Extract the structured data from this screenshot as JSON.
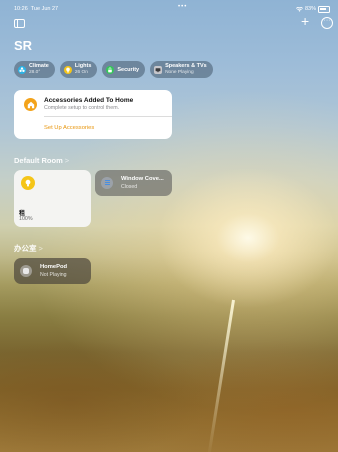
{
  "status_bar": {
    "time": "10:26",
    "date": "Tue Jun 27",
    "dots": "•••",
    "wifi": "wifi-icon",
    "battery_pct": "83%"
  },
  "home": {
    "title": "SR"
  },
  "pills": [
    {
      "label": "Climate",
      "sub": "28.0°",
      "icon": "fan-icon",
      "color": "#2bb3e6"
    },
    {
      "label": "Lights",
      "sub": "26 On",
      "icon": "bulb-icon",
      "color": "#f5c518"
    },
    {
      "label": "Security",
      "icon": "lock-icon",
      "color": "#34c759"
    },
    {
      "label": "Speakers & TVs",
      "sub": "None Playing",
      "icon": "tv-icon",
      "color": "#c7c7cc"
    }
  ],
  "accessories_card": {
    "title": "Accessories Added To Home",
    "subtitle": "Complete setup to control them.",
    "link": "Set Up Accessories",
    "icon": "home-icon",
    "icon_color": "#f3a31b"
  },
  "sections": [
    {
      "title": "Default Room",
      "chevron": ">",
      "tiles": [
        {
          "name": "租",
          "status": "100%",
          "icon": "bulb-icon"
        },
        {
          "name": "Window Cove...",
          "status": "Closed",
          "icon": "blinds-icon"
        }
      ]
    },
    {
      "title": "办公室",
      "chevron": ">",
      "tiles": [
        {
          "name": "HomePod",
          "status": "Not Playing",
          "icon": "homepod-icon"
        }
      ]
    }
  ],
  "accent_color": "#e8960e"
}
